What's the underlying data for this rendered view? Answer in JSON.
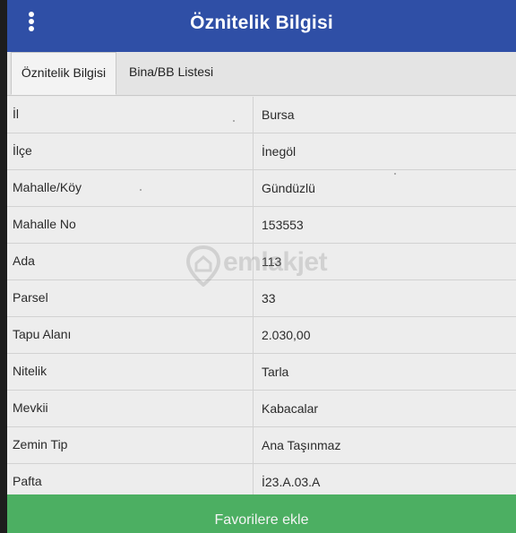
{
  "header": {
    "title": "Öznitelik Bilgisi"
  },
  "tabs": [
    {
      "label": "Öznitelik Bilgisi",
      "active": true
    },
    {
      "label": "Bina/BB Listesi",
      "active": false
    }
  ],
  "rows": [
    {
      "label": "İl",
      "value": "Bursa"
    },
    {
      "label": "İlçe",
      "value": "İnegöl"
    },
    {
      "label": "Mahalle/Köy",
      "value": "Gündüzlü"
    },
    {
      "label": "Mahalle No",
      "value": "153553"
    },
    {
      "label": "Ada",
      "value": "113"
    },
    {
      "label": "Parsel",
      "value": "33"
    },
    {
      "label": "Tapu Alanı",
      "value": "2.030,00"
    },
    {
      "label": "Nitelik",
      "value": "Tarla"
    },
    {
      "label": "Mevkii",
      "value": "Kabacalar"
    },
    {
      "label": "Zemin Tip",
      "value": "Ana Taşınmaz"
    },
    {
      "label": "Pafta",
      "value": "İ23.A.03.A"
    }
  ],
  "watermark": {
    "text": "emlakjet"
  },
  "footer": {
    "button_label": "Favorilere ekle"
  },
  "colors": {
    "header_bg": "#2f4fa6",
    "footer_bg": "#4caf62",
    "page_bg": "#ededed"
  }
}
